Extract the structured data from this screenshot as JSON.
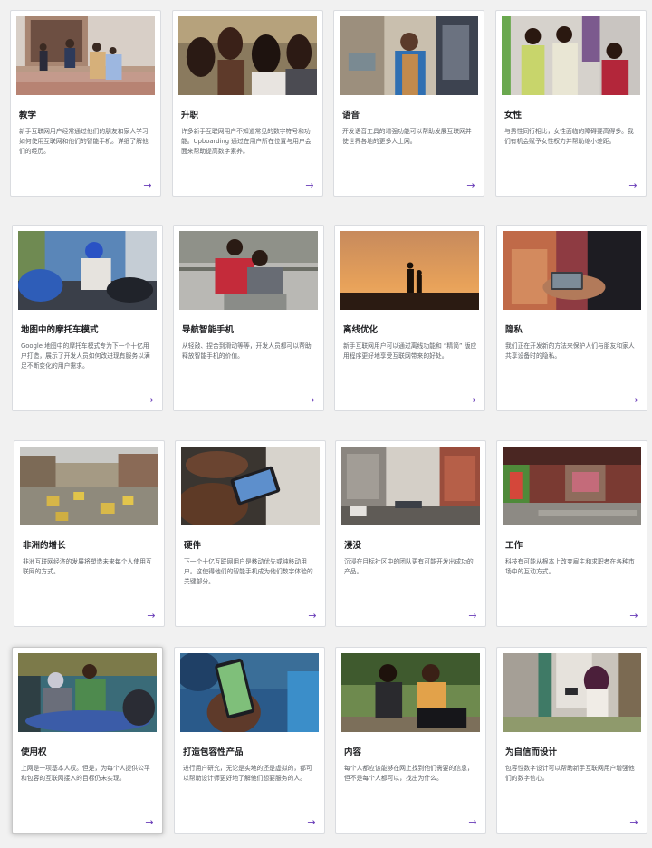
{
  "cards": [
    {
      "title": "教学",
      "desc": "新手互联网用户经常通过他们的朋友和家人学习如何使用互联网和他们的智能手机。详细了解他们的经历。",
      "arrow": "→"
    },
    {
      "title": "升职",
      "desc": "许多新手互联网用户不知道常见的数字符号和功能。Upboarding 通过在用户所在位置与用户会面来帮助提高数字素养。",
      "arrow": "→"
    },
    {
      "title": "语音",
      "desc": "开发语音工具的增强功能可以帮助发展互联网并使世界各地的更多人上网。",
      "arrow": "→"
    },
    {
      "title": "女性",
      "desc": "与男性同行相比，女性面临的障碍要高得多。我们有机会赋予女性权力并帮助缩小差距。",
      "arrow": "→"
    },
    {
      "title": "地图中的摩托车模式",
      "desc": "Google 地图中的摩托车模式专为下一个十亿用户打造，展示了开发人员如何改进现有服务以满足不断变化的用户需求。",
      "arrow": "→"
    },
    {
      "title": "导航智能手机",
      "desc": "从轻敲、捏合到滑动等等，开发人员都可以帮助释放智能手机的价值。",
      "arrow": "→"
    },
    {
      "title": "离线优化",
      "desc": "新手互联网用户可以通过离线功能和 “精简” 版应用程序更好地享受互联网带来的好处。",
      "arrow": "→"
    },
    {
      "title": "隐私",
      "desc": "我们正在开发新的方法来保护人们与朋友和家人共享设备时的隐私。",
      "arrow": "→"
    },
    {
      "title": "非洲的增长",
      "desc": "非洲互联网经济的发展将塑造未来每个人使用互联网的方式。",
      "arrow": "→"
    },
    {
      "title": "硬件",
      "desc": "下一个十亿互联网用户是移动优先或纯移动用户。这使得他们的智能手机成为他们数字体验的关键部分。",
      "arrow": "→"
    },
    {
      "title": "浸没",
      "desc": "沉浸在目标社区中的团队更有可能开发出成功的产品。",
      "arrow": "→"
    },
    {
      "title": "工作",
      "desc": "科技有可能从根本上改变雇主和求职者在各种市场中的互动方式。",
      "arrow": "→"
    },
    {
      "title": "使用权",
      "desc": "上网是一项基本人权。但是，为每个人提供公平和包容的互联网接入的目标仍未实现。",
      "arrow": "→"
    },
    {
      "title": "打造包容性产品",
      "desc": "进行用户研究，无论是实地的还是虚拟的，都可以帮助设计师更好地了解他们想要服务的人。",
      "arrow": "→"
    },
    {
      "title": "内容",
      "desc": "每个人都应该能够在网上找到他们需要的信息，但不是每个人都可以，找出为什么。",
      "arrow": "→"
    },
    {
      "title": "为自信而设计",
      "desc": "包容性数字设计可以帮助新手互联网用户增强他们的数字信心。",
      "arrow": "→"
    }
  ]
}
